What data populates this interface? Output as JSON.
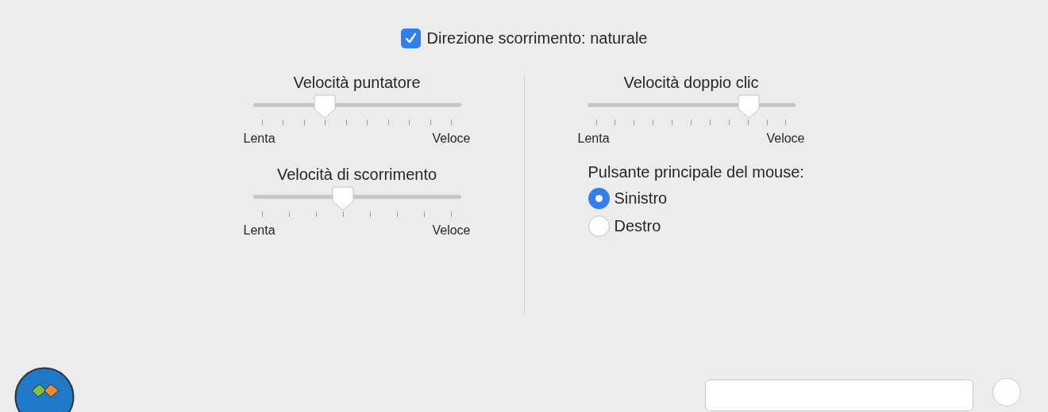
{
  "natural_scroll": {
    "label": "Direzione scorrimento: naturale",
    "checked": true
  },
  "sliders": [
    {
      "title": "Velocità puntatore",
      "min_label": "Lenta",
      "max_label": "Veloce",
      "level": 0.333
    },
    {
      "title": "Velocità di scorrimento",
      "min_label": "Lenta",
      "max_label": "Veloce",
      "level": 0.4286
    },
    {
      "title": "Velocità doppio clic",
      "min_label": "Lenta",
      "max_label": "Veloce",
      "level": 0.8
    }
  ],
  "primary_button": {
    "title": "Pulsante principale del mouse:",
    "options": [
      {
        "label": "Sinistro",
        "selected": true
      },
      {
        "label": "Destro",
        "selected": false
      }
    ]
  }
}
